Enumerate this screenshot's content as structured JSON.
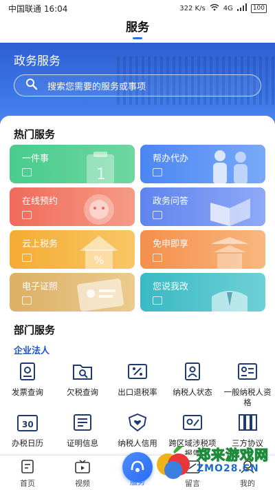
{
  "status_bar": {
    "carrier_time": "中国联通 16:04",
    "speed": "322 K/s",
    "network": "4G",
    "battery": "100"
  },
  "header": {
    "title": "服务"
  },
  "banner": {
    "title": "政务服务",
    "search_placeholder": "搜索您需要的服务或事项"
  },
  "hot_services": {
    "title": "热门服务",
    "tiles": [
      {
        "label": "一件事",
        "color": "#45c98a"
      },
      {
        "label": "帮办代办",
        "color": "#4f8cf5"
      },
      {
        "label": "在线预约",
        "color": "#f2705e"
      },
      {
        "label": "政务问答",
        "color": "#6a8ef2"
      },
      {
        "label": "云上税务",
        "color": "#f6b23c"
      },
      {
        "label": "免申即享",
        "color": "#f59a56"
      },
      {
        "label": "电子证照",
        "color": "#e3b86a"
      },
      {
        "label": "您说我改",
        "color": "#3fbfc8"
      }
    ]
  },
  "dept_services": {
    "title": "部门服务",
    "subtitle": "企业法人",
    "items": [
      {
        "label": "发票查询",
        "icon": "invoice-search-icon"
      },
      {
        "label": "欠税查询",
        "icon": "folder-search-icon"
      },
      {
        "label": "出口退税率",
        "icon": "percent-card-icon"
      },
      {
        "label": "纳税人状态",
        "icon": "person-doc-icon"
      },
      {
        "label": "一般纳税人资格",
        "icon": "person-list-icon"
      },
      {
        "label": "办税日历",
        "icon": "calendar-30-icon"
      },
      {
        "label": "证明信息",
        "icon": "certificate-icon"
      },
      {
        "label": "纳税人信用",
        "icon": "shield-heart-icon"
      },
      {
        "label": "跨区域涉税项报告",
        "icon": "map-pin-icon"
      },
      {
        "label": "三方协议",
        "icon": "agreement-icon"
      }
    ]
  },
  "tabbar": {
    "items": [
      {
        "label": "首页",
        "icon": "home-doc-icon"
      },
      {
        "label": "视频",
        "icon": "tv-icon"
      },
      {
        "label": "服务",
        "icon": "service-icon"
      },
      {
        "label": "留言",
        "icon": "message-icon"
      },
      {
        "label": "我的",
        "icon": "user-icon"
      }
    ]
  },
  "watermark": {
    "title": "郑来游戏网",
    "sub": "ZMO28.CN"
  },
  "colors": {
    "primary": "#2a6df4",
    "banner": "#3b75e6"
  }
}
